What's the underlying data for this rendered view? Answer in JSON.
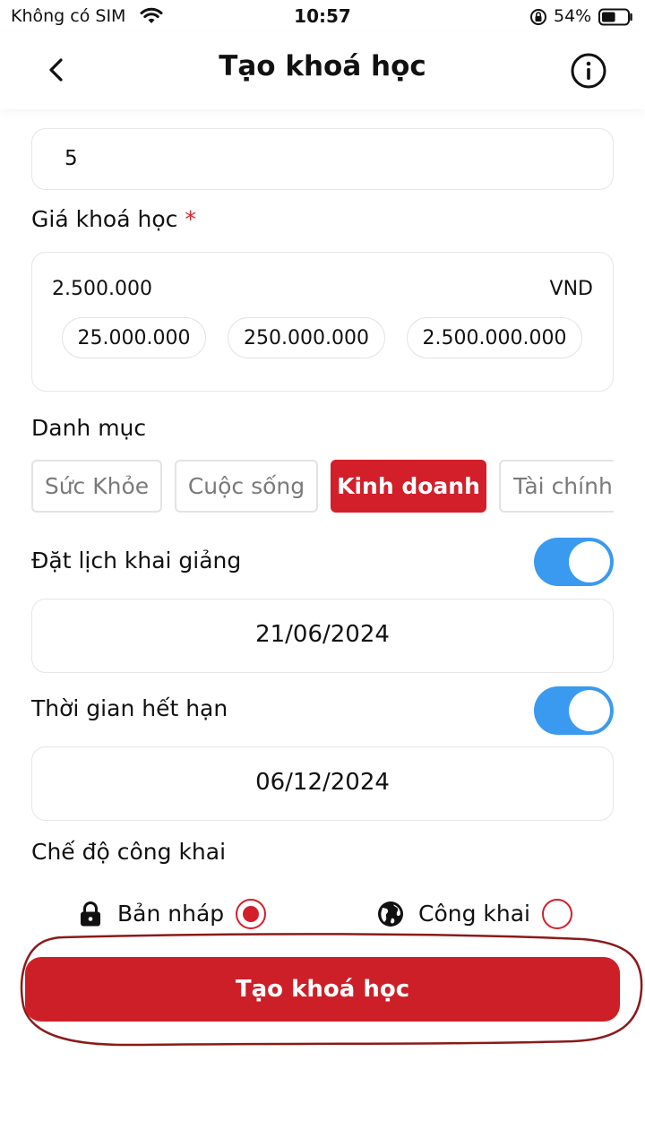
{
  "status_bar": {
    "carrier": "Không có SIM",
    "time": "10:57",
    "battery_percent": "54%",
    "battery_level": 0.54,
    "icons": [
      "wifi-icon",
      "orientation-lock-icon",
      "battery-icon"
    ]
  },
  "nav": {
    "title": "Tạo khoá học",
    "back_icon": "chevron-left-icon",
    "info_icon": "info-icon"
  },
  "lesson_count": {
    "value": "5"
  },
  "price": {
    "label": "Giá khoá học",
    "required_mark": "*",
    "value": "2.500.000",
    "currency": "VND",
    "suggestions": [
      "25.000.000",
      "250.000.000",
      "2.500.000.000"
    ]
  },
  "category": {
    "label": "Danh mục",
    "options": [
      "Sức Khỏe",
      "Cuộc sống",
      "Kinh doanh",
      "Tài chính"
    ],
    "selected": "Kinh doanh"
  },
  "schedule": {
    "label": "Đặt lịch khai giảng",
    "enabled": true,
    "date": "21/06/2024"
  },
  "expiry": {
    "label": "Thời gian hết hạn",
    "enabled": true,
    "date": "06/12/2024"
  },
  "visibility": {
    "label": "Chế độ công khai",
    "draft_label": "Bản nháp",
    "public_label": "Công khai",
    "selected": "Bản nháp"
  },
  "submit": {
    "label": "Tạo khoá học"
  },
  "colors": {
    "accent": "#d21f2a",
    "toggle_on": "#3a9aef",
    "annotation": "#8b1a1a"
  }
}
